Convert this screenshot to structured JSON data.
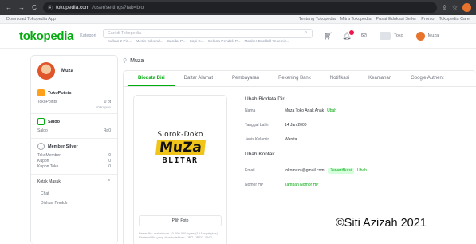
{
  "browser": {
    "url_host": "tokopedia.com",
    "url_path": "/user/settings?tab=bio",
    "back": "←",
    "forward": "→",
    "reload": "C",
    "lock": "⦿",
    "share": "⇪",
    "star": "☆"
  },
  "top_strip": {
    "download": "Download Tokopedia App",
    "links": [
      "Tentang Tokopedia",
      "Mitra Tokopedia",
      "Pusat Edukasi Seller",
      "Promo",
      "Tokopedia Care"
    ]
  },
  "header": {
    "logo": "tokopedia",
    "kategori": "Kategori",
    "search_placeholder": "Cari di Tokopedia",
    "suggestions": [
      "Kulkas 2 Pin...",
      "Mesin Sekend...",
      "Sandal P...",
      "Kopi K...",
      "Celana Pendek P...",
      "Masker Duckbill Tesemin..."
    ],
    "shop_label": "Toko",
    "user_label": "Muza"
  },
  "sidebar": {
    "user_name": "Muza",
    "tokopoints": {
      "title": "TokoPoints",
      "row_label": "TokoPoints",
      "row_value": "0 pt",
      "sub": "10 Kupon"
    },
    "saldo": {
      "title": "Saldo",
      "row_label": "Saldo",
      "row_value": "Rp0"
    },
    "member": {
      "title": "Member Silver",
      "rows": [
        {
          "label": "TokoMember",
          "value": "0"
        },
        {
          "label": "Kupon",
          "value": "0"
        },
        {
          "label": "Kupon Toko",
          "value": "0"
        }
      ]
    },
    "collapse_title": "Kotak Masuk",
    "collapse_items": [
      "Chat",
      "Diskusi Produk"
    ]
  },
  "content": {
    "breadcrumb": "Muza",
    "tabs": [
      "Biodata Diri",
      "Daftar Alamat",
      "Pembayaran",
      "Rekening Bank",
      "Notifikasi",
      "Keamanan",
      "Google Authent"
    ],
    "photo": {
      "top_text": "Slorok-Doko",
      "logo_text": "MuZa",
      "bottom_text": "BLITAR",
      "pick_button": "Pilih Foto",
      "hint": "Besar file: maksimum 10.000.000 bytes (10 Megabytes). Ekstensi file yang diperbolehkan: .JPG .JPEG .PNG"
    },
    "form": {
      "bio_heading": "Ubah Biodata Diri",
      "name_label": "Nama",
      "name_value": "Muza Toko Anak Anak",
      "name_link": "Ubah",
      "dob_label": "Tanggal Lahir",
      "dob_value": "14 Jan 2000",
      "gender_label": "Jenis Kelamin",
      "gender_value": "Wanita",
      "contact_heading": "Ubah Kontak",
      "email_label": "Email",
      "email_value": "tokomuza@gmail.com",
      "email_badge": "Terverifikasi",
      "email_link": "Ubah",
      "phone_label": "Nomor HP",
      "phone_link": "Tambah Nomor HP"
    }
  },
  "watermark": "©Siti Azizah 2021"
}
